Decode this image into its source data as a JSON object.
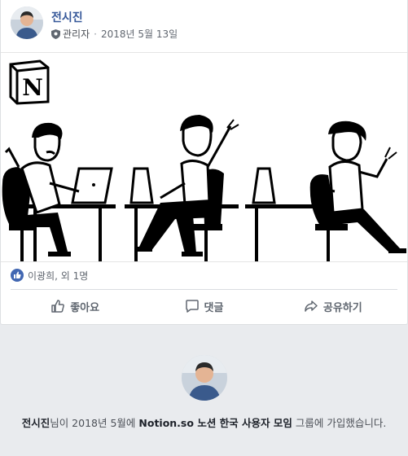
{
  "post": {
    "author": "전시진",
    "role": "관리자",
    "separator": "·",
    "date": "2018년 5월 13일",
    "image_logo": "N",
    "reactions_text": "이광희, 외 1명",
    "actions": {
      "like": "좋아요",
      "comment": "댓글",
      "share": "공유하기"
    }
  },
  "join_notice": {
    "name": "전시진",
    "part1": "님이 2018년 5월에 ",
    "group": "Notion.so 노션 한국 사용자 모임",
    "part2": " 그룹에 가입했습니다."
  },
  "colors": {
    "author_link": "#365899",
    "like_blue": "#4267b2",
    "background": "#e9ebee"
  }
}
